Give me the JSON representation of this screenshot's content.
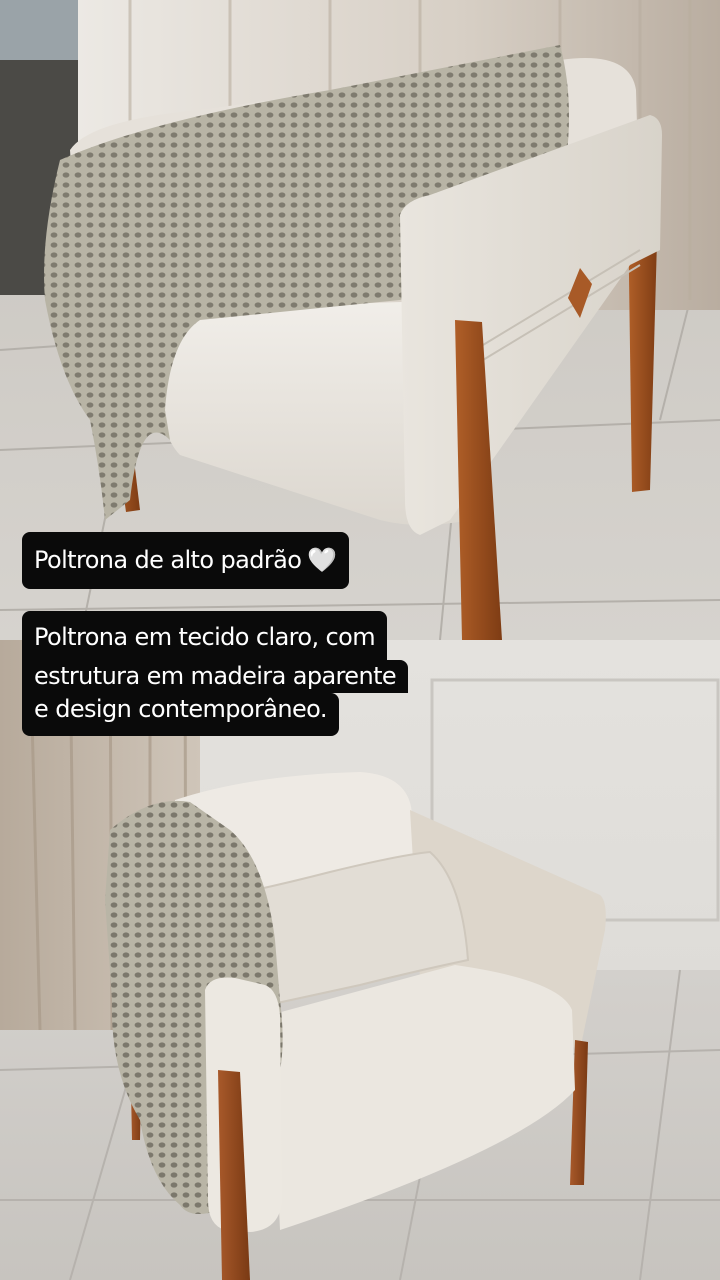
{
  "story": {
    "title": "Poltrona de alto padrão",
    "title_emoji": "🤍",
    "description_lines": [
      "Poltrona em tecido claro, com",
      "estrutura em madeira aparente",
      "e design contemporâneo."
    ]
  },
  "photos": [
    {
      "subject": "armchair-front-angle-with-knit-throw"
    },
    {
      "subject": "armchair-side-angle-with-cushion-and-knit-throw"
    }
  ],
  "colors": {
    "caption_bg": "#0a0a0a",
    "caption_text": "#ffffff",
    "upholstery": "#ece8e1",
    "wood": "#9a4d1f",
    "throw": "#b7b3a4",
    "floor": "#cfcbc6",
    "curtain": "#c9bfb3"
  }
}
